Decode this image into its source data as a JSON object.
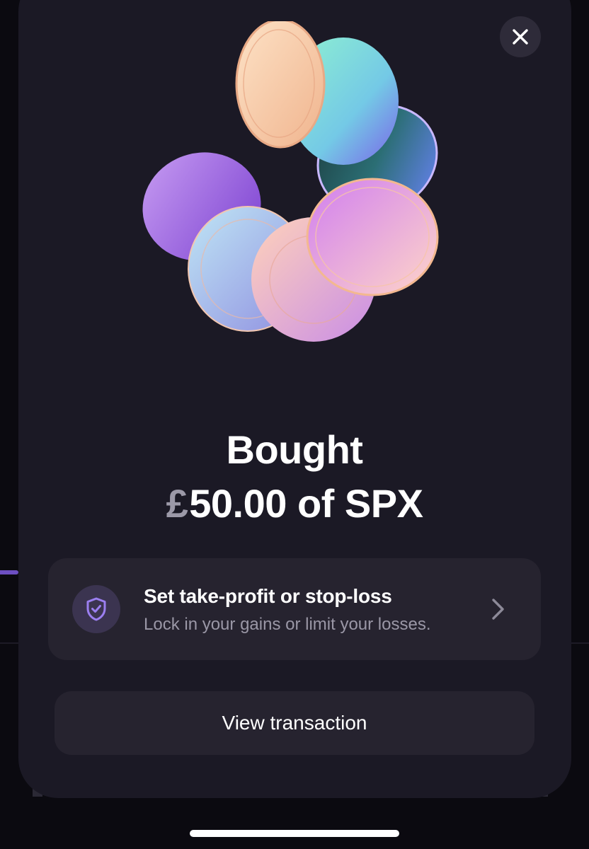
{
  "header": {
    "close_icon": "close-icon"
  },
  "illustration": {
    "name": "coins-illustration"
  },
  "confirmation": {
    "title": "Bought",
    "currency_symbol": "£",
    "amount": "50.00",
    "connector": "of",
    "ticker": "SPX"
  },
  "tpsl": {
    "icon": "shield-check-icon",
    "title": "Set take-profit or stop-loss",
    "subtitle": "Lock in your gains or limit your losses.",
    "chevron_icon": "chevron-right-icon"
  },
  "actions": {
    "view_transaction_label": "View transaction"
  },
  "colors": {
    "background": "#0b0a10",
    "sheet": "#1b1925",
    "card": "#26232f",
    "accent": "#8b6fe0",
    "muted_text": "#9a97a6"
  }
}
